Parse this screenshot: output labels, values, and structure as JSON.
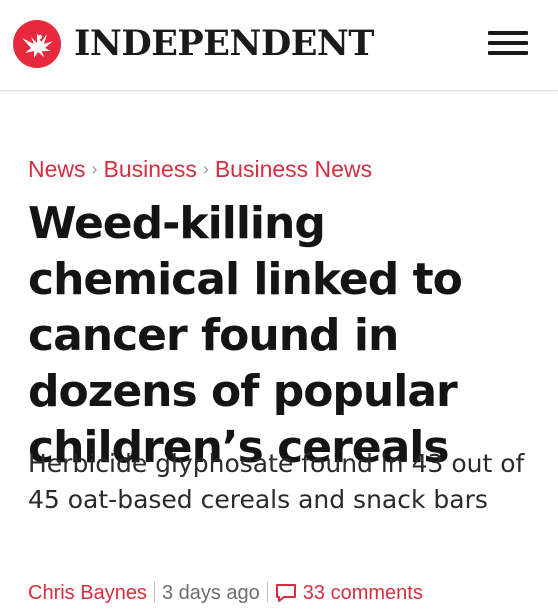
{
  "header": {
    "brand_name": "INDEPENDENT",
    "logo_icon": "eagle-logo-icon",
    "menu_icon": "hamburger-menu-icon",
    "brand_color": "#e8283c"
  },
  "breadcrumb": {
    "items": [
      {
        "label": "News"
      },
      {
        "label": "Business"
      },
      {
        "label": "Business News"
      }
    ],
    "separator": "›",
    "link_color": "#d62e3f"
  },
  "article": {
    "headline": "Weed-killing chemical linked to cancer found in dozens of popular children’s cereals",
    "standfirst": "Herbicide glyphosate found in 43 out of 45 oat-based cereals and snack bars"
  },
  "byline": {
    "author": "Chris Baynes",
    "time": "3 days ago",
    "comments_label": "33 comments",
    "comments_icon": "comment-bubble-icon"
  }
}
